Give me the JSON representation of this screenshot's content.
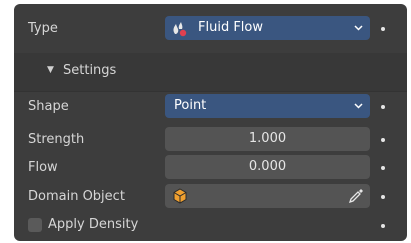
{
  "fields": {
    "type": {
      "label": "Type",
      "value": "Fluid Flow",
      "icon": "fluid-flow-icon"
    },
    "settings": {
      "label": "Settings",
      "expanded": true
    },
    "shape": {
      "label": "Shape",
      "value": "Point"
    },
    "strength": {
      "label": "Strength",
      "value": "1.000"
    },
    "flow": {
      "label": "Flow",
      "value": "0.000"
    },
    "domain_object": {
      "label": "Domain Object",
      "value": "",
      "icon": "object-icon",
      "picker_icon": "eyedropper-icon"
    },
    "apply_density": {
      "label": "Apply Density",
      "checked": false
    }
  },
  "colors": {
    "panel_bg": "#3d3d3d",
    "dropdown_bg": "#3a5680",
    "field_bg": "#545454",
    "text": "#d6d6d6"
  }
}
